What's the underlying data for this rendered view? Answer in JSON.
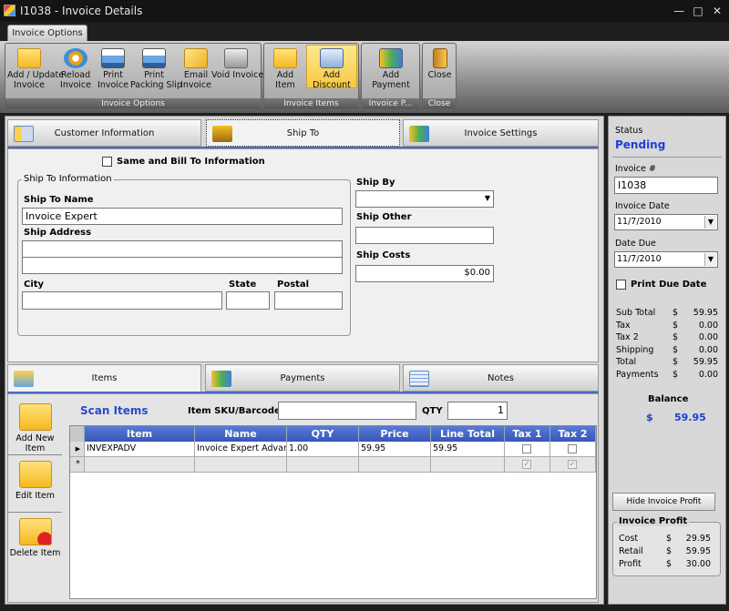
{
  "window": {
    "title": "I1038 - Invoice Details"
  },
  "ribbon": {
    "tab": "Invoice Options",
    "groups": [
      {
        "label": "Invoice Options",
        "buttons": [
          "Add / Update\nInvoice",
          "Reload\nInvoice",
          "Print\nInvoice",
          "Print\nPacking Slip",
          "Email\nInvoice",
          "Void Invoice"
        ]
      },
      {
        "label": "Invoice Items",
        "buttons": [
          "Add Item",
          "Add Discount"
        ]
      },
      {
        "label": "Invoice P...",
        "buttons": [
          "Add Payment"
        ]
      },
      {
        "label": "Close",
        "buttons": [
          "Close"
        ]
      }
    ]
  },
  "tabs_top": [
    "Customer Information",
    "Ship To",
    "Invoice Settings"
  ],
  "shipto": {
    "same_label": "Same and Bill To Information",
    "group_legend": "Ship To Information",
    "name_label": "Ship To Name",
    "name_value": "Invoice Expert",
    "address_label": "Ship Address",
    "city_label": "City",
    "state_label": "State",
    "postal_label": "Postal",
    "shipby_label": "Ship By",
    "shipother_label": "Ship Other",
    "shipcosts_label": "Ship Costs",
    "shipcosts_value": "$0.00"
  },
  "tabs_bottom": [
    "Items",
    "Payments",
    "Notes"
  ],
  "items": {
    "scan_label": "Scan Items",
    "sku_label": "Item SKU/Barcode",
    "qty_label": "QTY",
    "qty_value": "1",
    "side_buttons": [
      "Add New Item",
      "Edit Item",
      "Delete Item"
    ],
    "columns": [
      "Item",
      "Name",
      "QTY",
      "Price",
      "Line Total",
      "Tax 1",
      "Tax 2"
    ],
    "rows": [
      {
        "item": "INVEXPADV",
        "name": "Invoice Expert Advan",
        "qty": "1.00",
        "price": "59.95",
        "line_total": "59.95"
      }
    ]
  },
  "right": {
    "status_label": "Status",
    "status_value": "Pending",
    "invoice_no_label": "Invoice #",
    "invoice_no_value": "I1038",
    "invoice_date_label": "Invoice Date",
    "invoice_date_value": "11/7/2010",
    "date_due_label": "Date Due",
    "date_due_value": "11/7/2010",
    "print_due_label": "Print Due Date",
    "totals": [
      {
        "label": "Sub Total",
        "cur": "$",
        "val": "59.95"
      },
      {
        "label": "Tax",
        "cur": "$",
        "val": "0.00"
      },
      {
        "label": "Tax 2",
        "cur": "$",
        "val": "0.00"
      },
      {
        "label": "Shipping",
        "cur": "$",
        "val": "0.00"
      },
      {
        "label": "Total",
        "cur": "$",
        "val": "59.95"
      },
      {
        "label": "Payments",
        "cur": "$",
        "val": "0.00"
      }
    ],
    "balance_label": "Balance",
    "balance_cur": "$",
    "balance_value": "59.95",
    "hide_profit_label": "Hide Invoice Profit",
    "profit_legend": "Invoice Profit",
    "profit": [
      {
        "label": "Cost",
        "cur": "$",
        "val": "29.95"
      },
      {
        "label": "Retail",
        "cur": "$",
        "val": "59.95"
      },
      {
        "label": "Profit",
        "cur": "$",
        "val": "30.00"
      }
    ]
  },
  "colors": {
    "accent": "#3656b8",
    "status": "#1a3fd6",
    "highlight": "#f8c840"
  }
}
